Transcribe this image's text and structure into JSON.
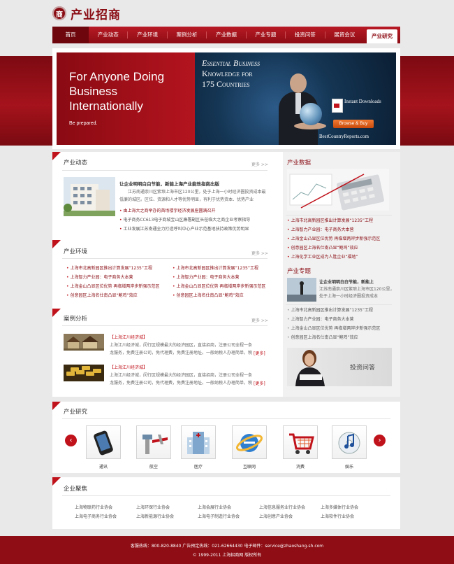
{
  "logo": {
    "mark": "商",
    "text": "产业招商"
  },
  "nav": [
    "首页",
    "产业动态",
    "产业环境",
    "案例分析",
    "产业数据",
    "产业专题",
    "投资问答",
    "展贸会议",
    "产业研究"
  ],
  "banner": {
    "headline": "For Anyone Doing Business Internationally",
    "tagline": "Be prepared.",
    "ad_line1": "Essential Business",
    "ad_line2": "Knowledge for",
    "ad_line3": "175 Countries",
    "instant": "Instant Downloads",
    "buy": "Browse & Buy",
    "site": "BestCountryReports.com"
  },
  "dynamics": {
    "title": "产业动态",
    "more": "更多 >>",
    "feature_title": "让企业明明白白节能，新能上海产业能效指南出版",
    "feature_text": "江苏南通崇川区紫琅上海市区120公里，处于上海一小时经济圈投资成本最低廉的城区。区位、资源和人才等优势明显，有利于优势资本、优势产业",
    "links": [
      "由上海大之商举办的首场楼宇经济发展座圆满召开",
      "电子商务CC613电子商城宝山区廉署副区长莅临大之商企业考察指导",
      "工业发展江苏南通全力打造呼叫中心产业示范基地扶持政策优势明显"
    ]
  },
  "environment": {
    "title": "产业环境",
    "more": "更多 >>",
    "col1": [
      "上海市北高新园区推出计算发展“1235”工程",
      "上海智力产业园：电子商务大本营",
      "上海金山凸显区位优势 再临增两岸步新强示范区",
      "创意园区上海名仕南凸显“鲍鸡”效应"
    ],
    "col2": [
      "上海市北高新园区推出计算发展“1235”工程",
      "上海智力产业园：电子商务大本营",
      "上海金山凸显区位优势 再临增两岸步新强示范区",
      "创意园区上海名仕南凸显“鲍鸡”效应"
    ]
  },
  "cases": {
    "title": "案例分析",
    "more": "更多 >>",
    "items": [
      {
        "tag": "【上海江川经济城】",
        "text": "上海江川经济城，闵行区规模最大的经济园区，直接招商，注册公司全程一条龙服务，免费注册公司，免代理费，免费注册地址。一般纳税人办理简单，税",
        "more": "[更多]"
      },
      {
        "tag": "【上海江川经济城】",
        "text": "上海江川经济城，闵行区规模最大的经济园区，直接招商，注册公司全程一条龙服务，免费注册公司，免代理费，免费注册地址。一般纳税人办理简单，税",
        "more": "[更多]"
      }
    ]
  },
  "data_panel": {
    "title": "产业数据",
    "links": [
      "上海市北高新园区推出计算发展“1235”工程",
      "上海智力产业园：电子商务大本营",
      "上海金山凸显区位优势 再临增两岸步新强示范区",
      "创意园区上海名仕南凸显“鲍鸡”效应",
      "上海化学工业区成为人胜企业“福地”"
    ]
  },
  "topic_panel": {
    "title": "产业专题",
    "feature_title": "让企业明明白白节能，新能上",
    "feature_text": "江苏南通崇川区紫琅上海市区120公里，处于上海一小时经济圈投资成本",
    "links": [
      "上海市北高新园区推出计算发展“1235”工程",
      "上海智力产业园：电子商务大本营",
      "上海金山凸显区位优势 再临增两岸步新强示范区",
      "创意园区上海名仕南凸显“鲍鸡”效应"
    ],
    "qa_label": "投资问答"
  },
  "research": {
    "title": "产业研究",
    "prev": "‹",
    "next": "›",
    "items": [
      "通讯",
      "航空",
      "医疗",
      "互联网",
      "消费",
      "娱乐"
    ]
  },
  "assoc": {
    "title": "企业聚焦",
    "items": [
      "上海物联药行业协会",
      "上海环保行业协会",
      "上海会展行业协会",
      "上海信息服务业行业协会",
      "上海多媒体行业协会",
      "上海电子商务行业协会",
      "上海新能源行业协会",
      "上海电子制造行业协会",
      "上海创意产业协会",
      "上海软件行业协会"
    ]
  },
  "footer": {
    "line1": "客服热线：800-820-8840  广告预定热线：021-62664430  电子邮件：service@zhaoshang-sh.com",
    "line2": "© 1999-2011  上海招商网  版权所有"
  }
}
